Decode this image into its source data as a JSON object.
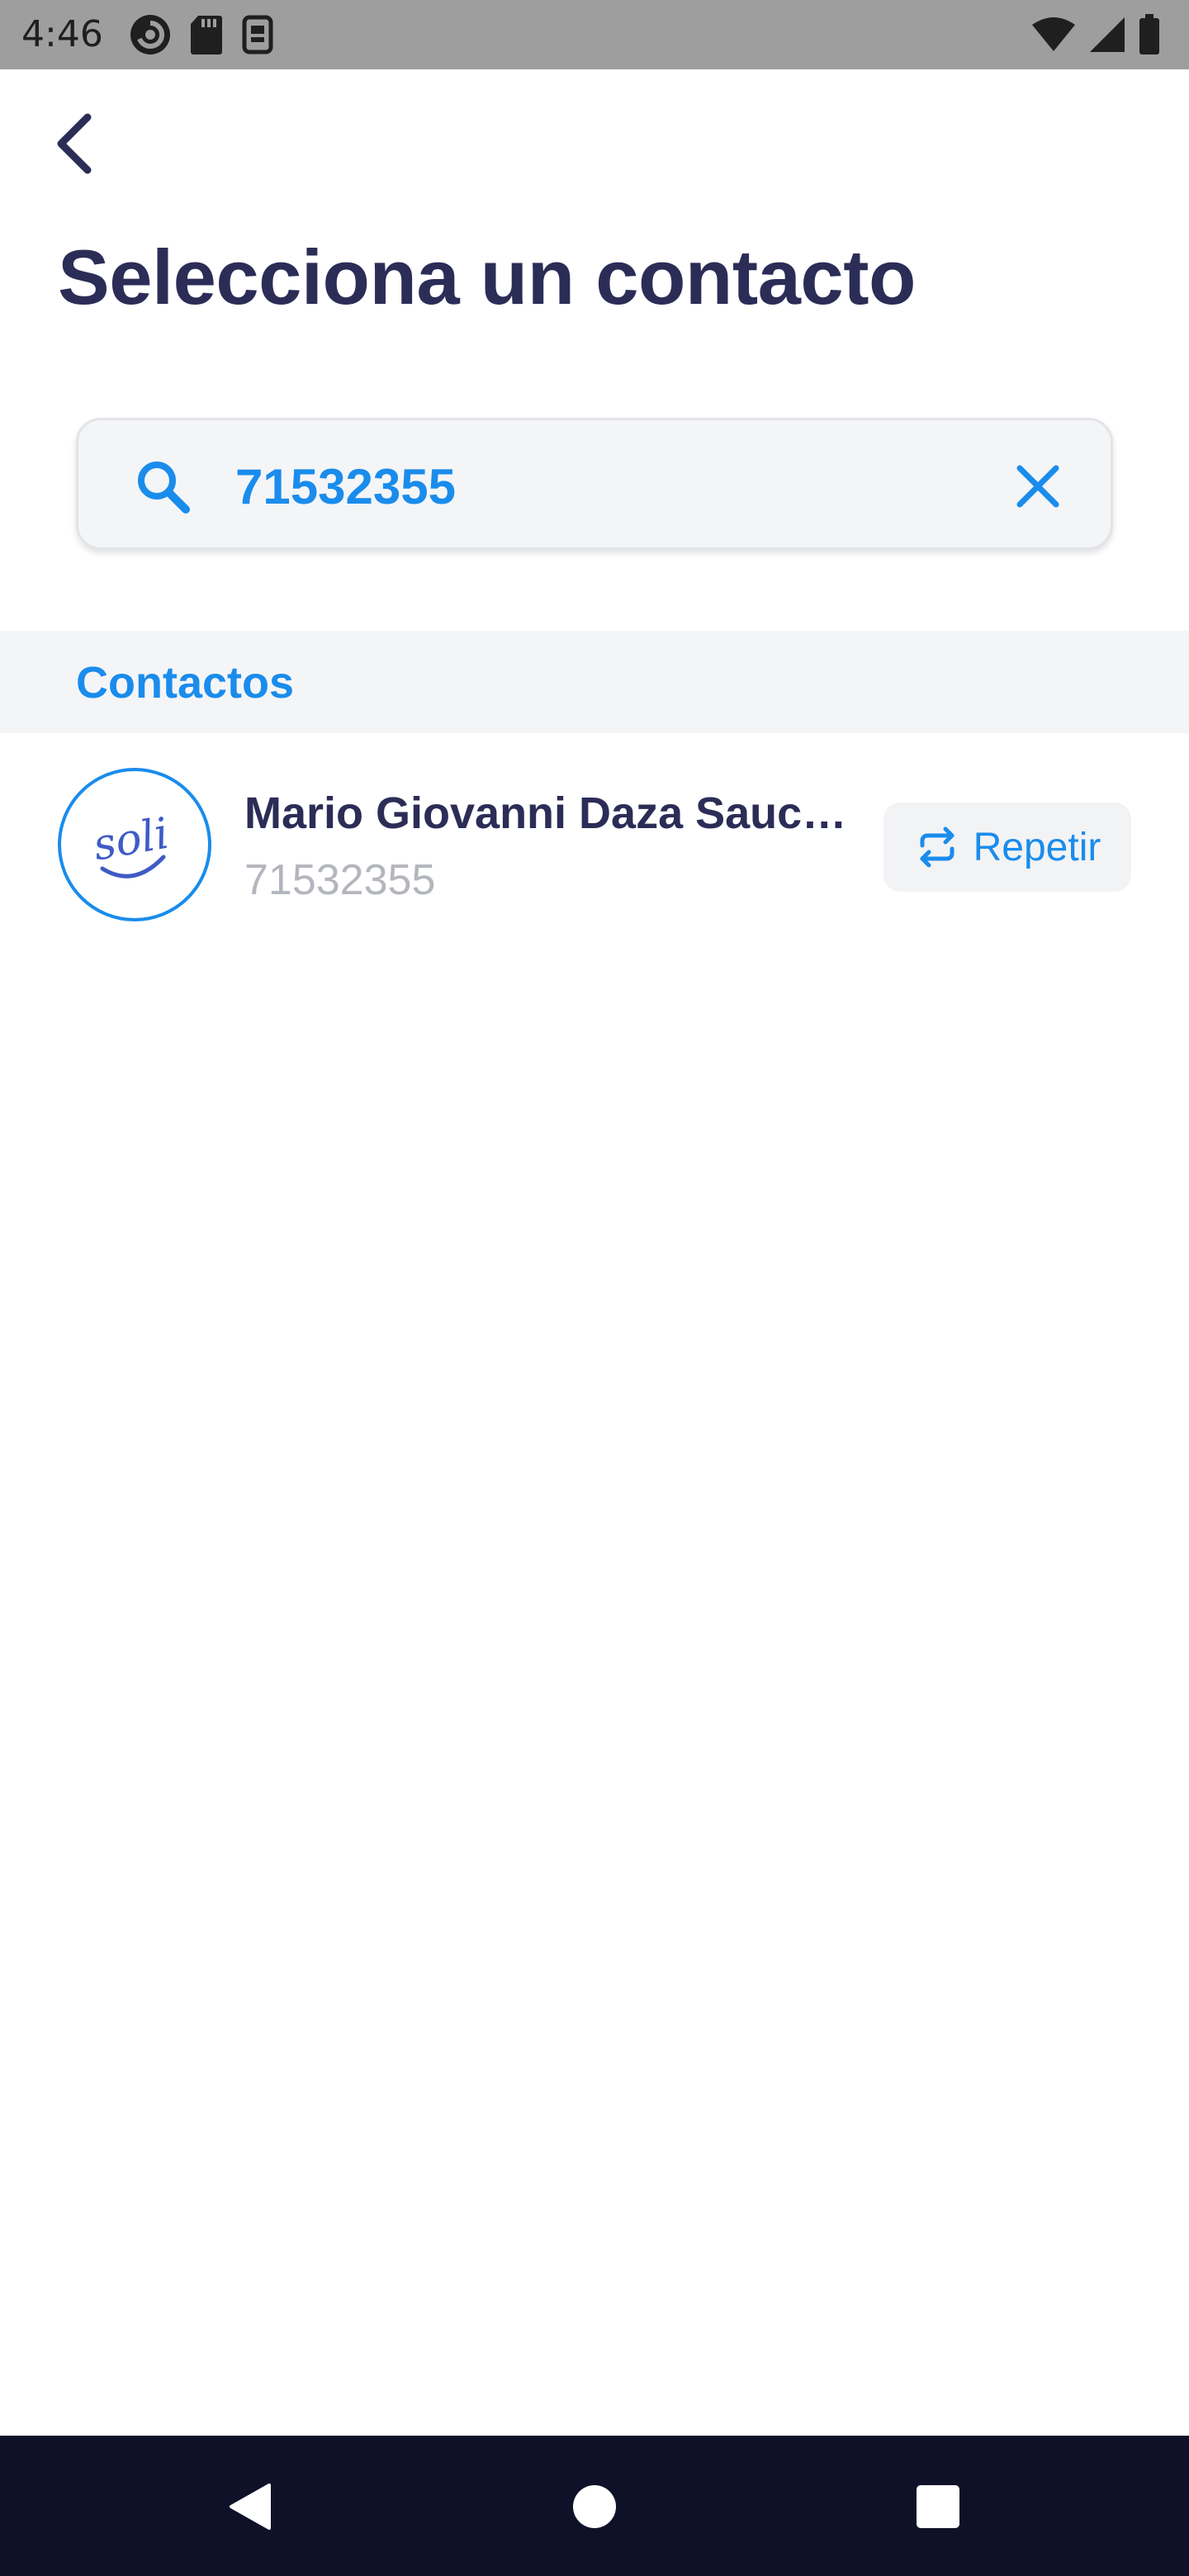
{
  "status_bar": {
    "time": "4:46",
    "icons_left": [
      "data-saver-icon",
      "sd-card-icon",
      "screenshot-icon"
    ],
    "icons_right": [
      "wifi-icon",
      "signal-icon",
      "battery-icon"
    ]
  },
  "header": {
    "back_icon": "chevron-left-icon",
    "title": "Selecciona un contacto"
  },
  "search": {
    "value": "71532355",
    "search_icon": "search-icon",
    "clear_icon": "close-icon"
  },
  "contacts_section": {
    "title": "Contactos",
    "items": [
      {
        "avatar_text": "soli",
        "name": "Mario Giovanni Daza Sauce...",
        "phone": "71532355",
        "action_label": "Repetir",
        "action_icon": "repeat-icon"
      }
    ]
  },
  "nav_bar": {
    "buttons": [
      "back-triangle-icon",
      "home-circle-icon",
      "recents-square-icon"
    ]
  },
  "colors": {
    "accent": "#1a8cec",
    "title": "#2b2d57",
    "muted": "#b4b6bd",
    "section_bg": "#f4f5f7",
    "nav_bg": "#0f1129"
  }
}
